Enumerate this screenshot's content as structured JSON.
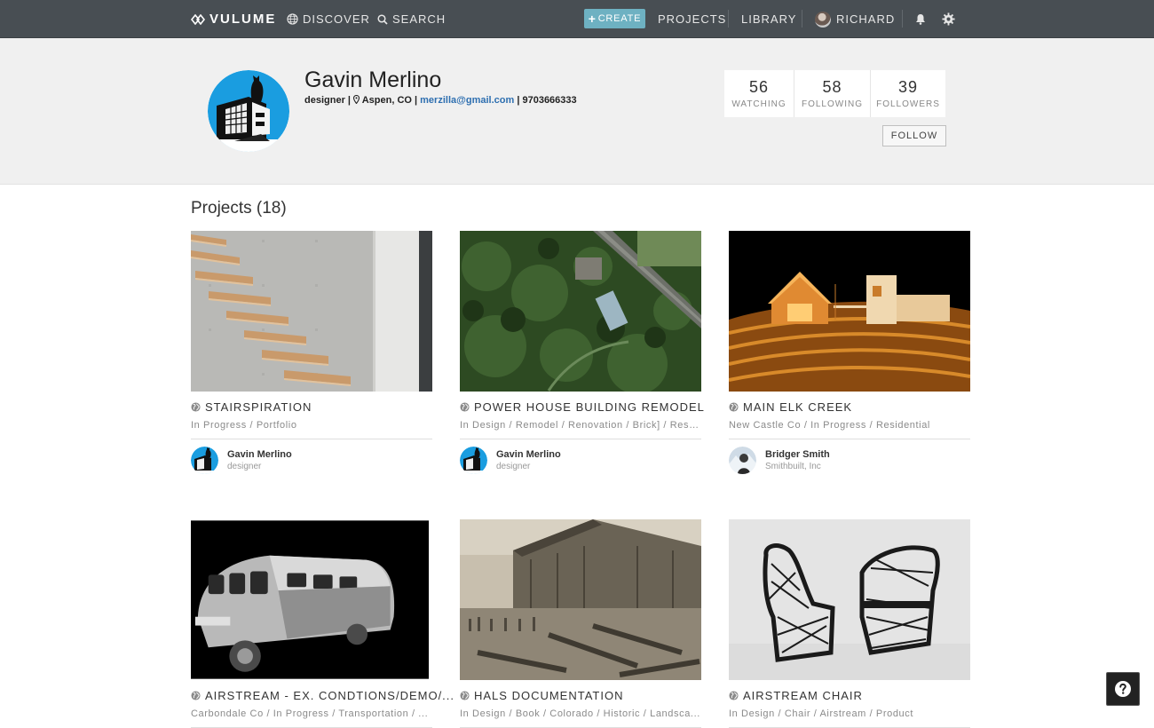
{
  "nav": {
    "logo": "VULUME",
    "discover": "DISCOVER",
    "search": "SEARCH",
    "create": "CREATE",
    "projects": "PROJECTS",
    "library": "LIBRARY",
    "user": "RICHARD",
    "icons": [
      "vulume-logo-icon",
      "globe-icon",
      "search-icon",
      "plus-icon",
      "avatar",
      "bell-icon",
      "gear-icon"
    ]
  },
  "profile": {
    "name": "Gavin Merlino",
    "role": "designer",
    "location": "Aspen, CO",
    "email": "merzilla@gmail.com",
    "phone": "9703666333",
    "stats": [
      {
        "num": "56",
        "label": "WATCHING"
      },
      {
        "num": "58",
        "label": "FOLLOWING"
      },
      {
        "num": "39",
        "label": "FOLLOWERS"
      }
    ],
    "follow_label": "FOLLOW"
  },
  "projects": {
    "heading": "Projects (18)",
    "cards": [
      {
        "title": "STAIRSPIRATION",
        "tags": "In Progress / Portfolio",
        "owner": "Gavin Merlino",
        "owner_role": "designer"
      },
      {
        "title": "POWER HOUSE BUILDING REMODEL",
        "tags": "In Design / Remodel / Renovation / Brick] / Rest...",
        "owner": "Gavin Merlino",
        "owner_role": "designer"
      },
      {
        "title": "MAIN ELK CREEK",
        "tags": "New Castle Co / In Progress / Residential",
        "owner": "Bridger Smith",
        "owner_role": "Smithbuilt, Inc"
      },
      {
        "title": "AIRSTREAM - EX. CONDTIONS/DEMO/...",
        "tags": "Carbondale Co / In Progress / Transportation / ...",
        "owner": "",
        "owner_role": ""
      },
      {
        "title": "HALS DOCUMENTATION",
        "tags": "In Design / Book / Colorado / Historic / Landsca...",
        "owner": "",
        "owner_role": ""
      },
      {
        "title": "AIRSTREAM CHAIR",
        "tags": "In Design / Chair / Airstream / Product",
        "owner": "",
        "owner_role": ""
      }
    ]
  },
  "colors": {
    "nav_bg": "#484e53",
    "accent": "#6eb1c2",
    "profile_bg": "#f0f0f0",
    "link": "#2e6fb0"
  }
}
